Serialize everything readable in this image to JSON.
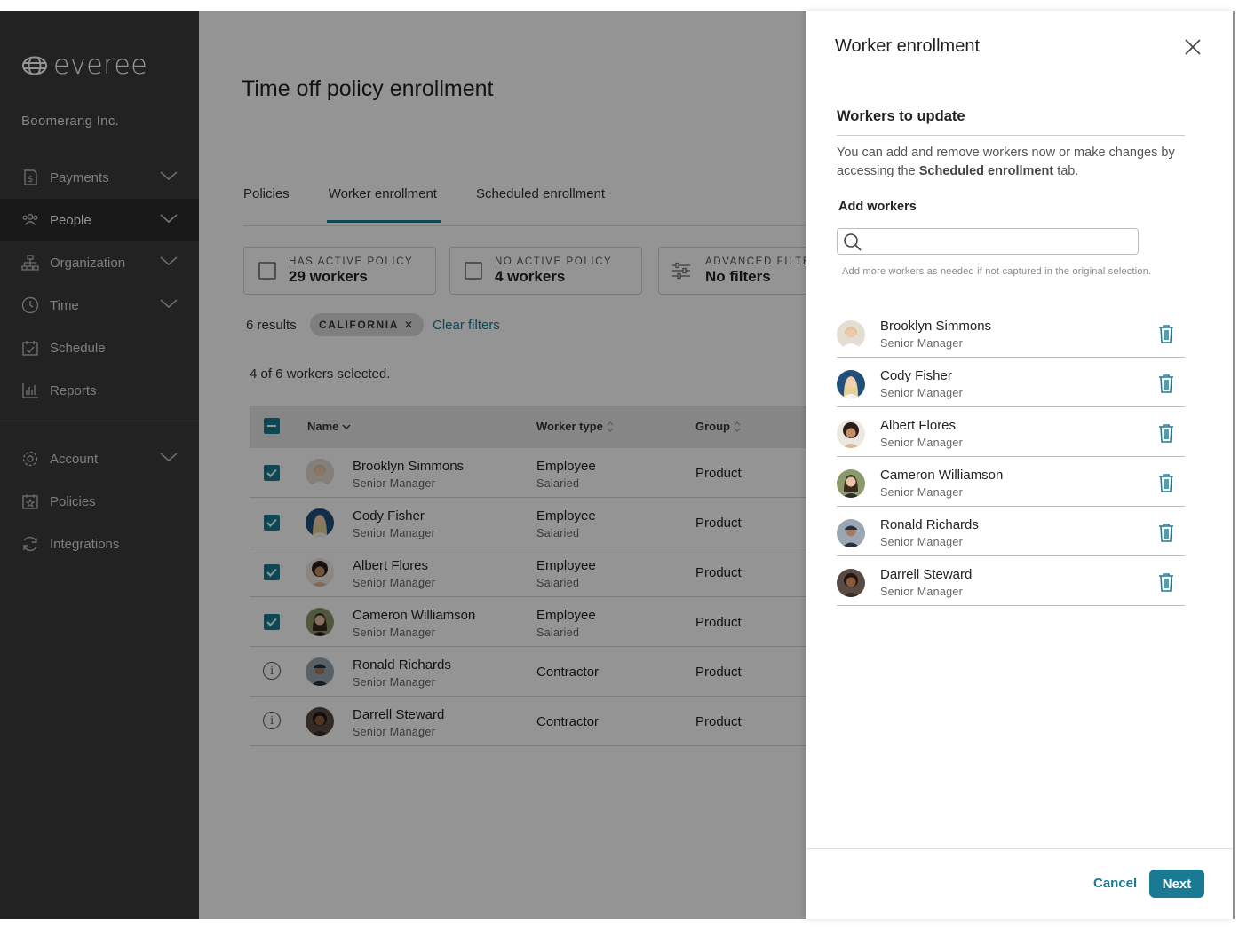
{
  "brand": {
    "name": "everee",
    "accent": "#1b7a93"
  },
  "sidebar": {
    "company": "Boomerang Inc.",
    "items": [
      {
        "label": "Payments",
        "icon": "receipt-dollar-icon",
        "has_chevron": true
      },
      {
        "label": "People",
        "icon": "people-icon",
        "has_chevron": true,
        "active": true
      },
      {
        "label": "Organization",
        "icon": "org-chart-icon",
        "has_chevron": true
      },
      {
        "label": "Time",
        "icon": "clock-icon",
        "has_chevron": true
      },
      {
        "label": "Schedule",
        "icon": "calendar-check-icon",
        "has_chevron": false
      },
      {
        "label": "Reports",
        "icon": "bar-chart-icon",
        "has_chevron": false
      }
    ],
    "items2": [
      {
        "label": "Account",
        "icon": "gear-icon",
        "has_chevron": true
      },
      {
        "label": "Policies",
        "icon": "calendar-star-icon",
        "has_chevron": false
      },
      {
        "label": "Integrations",
        "icon": "sync-icon",
        "has_chevron": false
      }
    ]
  },
  "main": {
    "title": "Time off policy enrollment",
    "tabs": [
      {
        "label": "Policies"
      },
      {
        "label": "Worker enrollment",
        "active": true
      },
      {
        "label": "Scheduled enrollment"
      }
    ],
    "filters": [
      {
        "label": "HAS ACTIVE POLICY",
        "value": "29 workers"
      },
      {
        "label": "NO ACTIVE POLICY",
        "value": "4 workers"
      },
      {
        "label": "ADVANCED FILTE",
        "value": "No filters"
      }
    ],
    "results": "6 results",
    "chip": "CALIFORNIA",
    "clear_filters": "Clear filters",
    "selected_text": "4 of 6 workers selected.",
    "table": {
      "columns": [
        "Name",
        "Worker type",
        "Group"
      ],
      "rows": [
        {
          "name": "Brooklyn Simmons",
          "title": "Senior Manager",
          "type": "Employee",
          "subtype": "Salaried",
          "group": "Product",
          "selected": true
        },
        {
          "name": "Cody Fisher",
          "title": "Senior Manager",
          "type": "Employee",
          "subtype": "Salaried",
          "group": "Product",
          "selected": true
        },
        {
          "name": "Albert Flores",
          "title": "Senior Manager",
          "type": "Employee",
          "subtype": "Salaried",
          "group": "Product",
          "selected": true
        },
        {
          "name": "Cameron Williamson",
          "title": "Senior Manager",
          "type": "Employee",
          "subtype": "Salaried",
          "group": "Product",
          "selected": true
        },
        {
          "name": "Ronald Richards",
          "title": "Senior Manager",
          "type": "Contractor",
          "subtype": "",
          "group": "Product",
          "selected": false
        },
        {
          "name": "Darrell Steward",
          "title": "Senior Manager",
          "type": "Contractor",
          "subtype": "",
          "group": "Product",
          "selected": false
        }
      ]
    }
  },
  "modal": {
    "title": "Worker enrollment",
    "section_title": "Workers to update",
    "desc_before": "You can add and remove workers now or make changes by accessing the ",
    "desc_bold": "Scheduled enrollment",
    "desc_after": " tab.",
    "add_label": "Add workers",
    "search_placeholder": "",
    "hint": "Add more workers as needed if not captured in the original selection.",
    "workers": [
      {
        "name": "Brooklyn Simmons",
        "title": "Senior Manager"
      },
      {
        "name": "Cody Fisher",
        "title": "Senior Manager"
      },
      {
        "name": "Albert Flores",
        "title": "Senior Manager"
      },
      {
        "name": "Cameron Williamson",
        "title": "Senior Manager"
      },
      {
        "name": "Ronald Richards",
        "title": "Senior Manager"
      },
      {
        "name": "Darrell Steward",
        "title": "Senior Manager"
      }
    ],
    "cancel_label": "Cancel",
    "next_label": "Next"
  }
}
